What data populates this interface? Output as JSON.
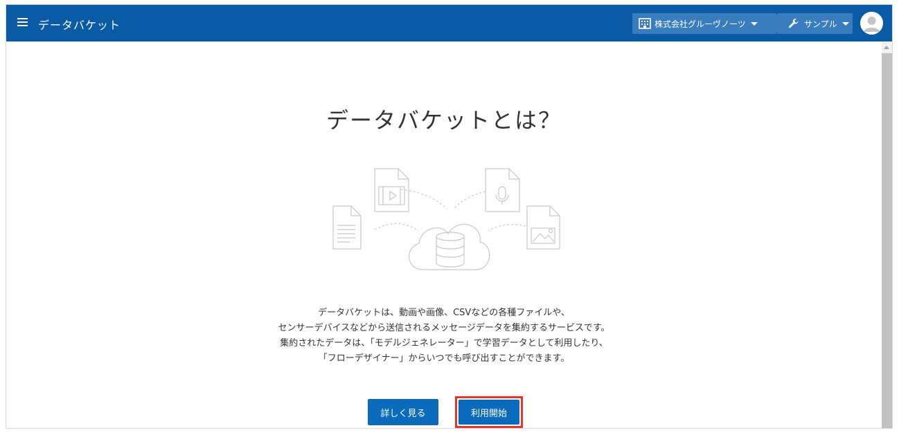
{
  "header": {
    "app_title": "データバケット",
    "org_selector": "株式会社グルーヴノーツ",
    "project_selector": "サンプル"
  },
  "main": {
    "title": "データバケットとは？",
    "description_lines": [
      "データバケットは、動画や画像、CSVなどの各種ファイルや、",
      "センサーデバイスなどから送信されるメッセージデータを集約するサービスです。",
      "集約されたデータは、「モデルジェネレーター」で学習データとして利用したり、",
      "「フローデザイナー」からいつでも呼び出すことができます。"
    ],
    "details_button": "詳しく見る",
    "start_button": "利用開始"
  },
  "colors": {
    "header_bg": "#0a5ba6",
    "breadcrumb_bg": "#3a7dbf",
    "button_bg": "#0a6bbd",
    "highlight_border": "#e5352a"
  },
  "icons": [
    "menu-icon",
    "building-icon",
    "wrench-icon",
    "avatar",
    "document-icon",
    "video-file-icon",
    "audio-file-icon",
    "image-file-icon",
    "cloud-database-icon"
  ]
}
